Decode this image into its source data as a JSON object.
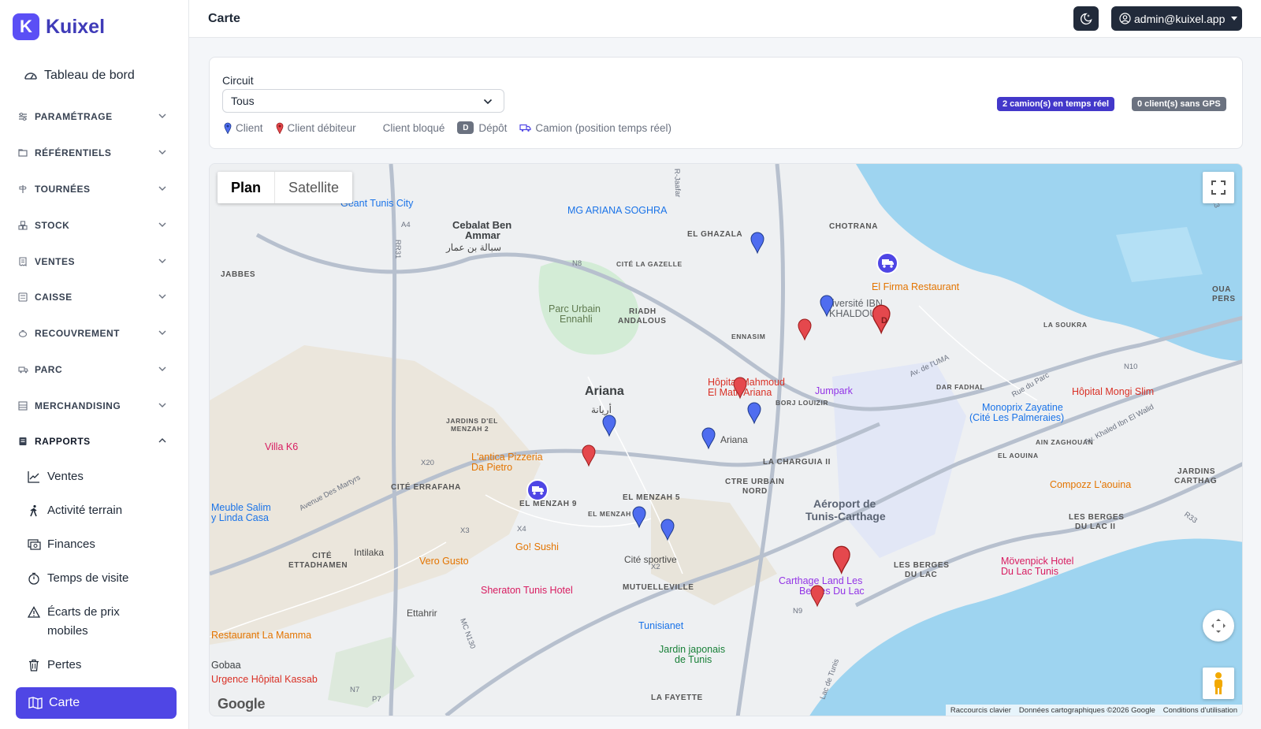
{
  "brand": {
    "name": "Kuixel",
    "logo_letter": "K"
  },
  "sidebar": {
    "dashboard": "Tableau de bord",
    "groups": [
      {
        "label": "PARAMÉTRAGE",
        "icon": "sliders-icon"
      },
      {
        "label": "RÉFÉRENTIELS",
        "icon": "folder-icon"
      },
      {
        "label": "TOURNÉES",
        "icon": "signpost-icon"
      },
      {
        "label": "STOCK",
        "icon": "boxes-icon"
      },
      {
        "label": "VENTES",
        "icon": "receipt-icon"
      },
      {
        "label": "CAISSE",
        "icon": "cash-register-icon"
      },
      {
        "label": "RECOUVREMENT",
        "icon": "piggy-bank-icon"
      },
      {
        "label": "PARC",
        "icon": "truck-icon"
      },
      {
        "label": "MERCHANDISING",
        "icon": "shelf-icon"
      },
      {
        "label": "RAPPORTS",
        "icon": "report-icon"
      }
    ],
    "report_items": [
      {
        "label": "Ventes",
        "icon": "graph-up-icon"
      },
      {
        "label": "Activité terrain",
        "icon": "person-walking-icon"
      },
      {
        "label": "Finances",
        "icon": "cash-icon"
      },
      {
        "label": "Temps de visite",
        "icon": "stopwatch-icon"
      },
      {
        "label": "Écarts de prix mobiles",
        "icon": "warning-icon"
      },
      {
        "label": "Pertes",
        "icon": "trash-icon"
      }
    ],
    "active_item": "Carte"
  },
  "header": {
    "title": "Carte",
    "user": "admin@kuixel.app"
  },
  "filters": {
    "circuit_label": "Circuit",
    "circuit_value": "Tous",
    "legend": {
      "client": "Client",
      "debtor": "Client débiteur",
      "blocked": "Client bloqué",
      "depot_letter": "D",
      "depot": "Dépôt",
      "truck": "Camion (position temps réel)"
    },
    "badge_trucks": "2 camion(s) en temps réel",
    "badge_nogps": "0 client(s) sans GPS"
  },
  "map": {
    "type_plan": "Plan",
    "type_satellite": "Satellite",
    "logo": "Google",
    "attribution": [
      "Raccourcis clavier",
      "Données cartographiques ©2026 Google",
      "Conditions d'utilisation"
    ],
    "labels": {
      "ariana": "Ariana",
      "ariana_ar": "أريانة",
      "cebalat": "Cebalat Ben",
      "cebalat2": "Ammar",
      "cebalat_ar": "سبالة بن عمار",
      "ghazala": "EL GHAZALA",
      "chotrana": "CHOTRANA",
      "jabbes": "JABBES",
      "cite_gazelle": "CITÉ LA GAZELLE",
      "parc_urbain": "Parc Urbain",
      "parc_urbain2": "Ennahli",
      "riadh": "RIADH",
      "riadh2": "ANDALOUS",
      "ennasim": "ENNASIM",
      "la_soukra": "LA SOUKRA",
      "dar_fadhal": "DAR FADHAL",
      "borj_louizir": "BORJ LOUIZIR",
      "jardins_menzah": "JARDINS D'EL",
      "jardins_menzah2": "MENZAH 2",
      "cite_erraf": "CITÉ ERRAFAHA",
      "el_menzah9": "EL MENZAH 9",
      "el_menzah5": "EL MENZAH 5",
      "el_menzah": "EL MENZAH",
      "la_charguia": "LA CHARGUIA II",
      "ctre_urbain": "CTRE URBAIN",
      "ctre_urbain2": "NORD",
      "aeroport": "Aéroport de",
      "aeroport2": "Tunis-Carthage",
      "el_aouina": "EL AOUINA",
      "ain_zaghouan": "AIN ZAGHOUAN",
      "jardins_carthage": "JARDINS",
      "jardins_carthage2": "CARTHAG",
      "berges_lac2": "LES BERGES",
      "berges_lac2b": "DU LAC II",
      "berges_lac": "LES BERGES",
      "berges_lac_b": "DU LAC",
      "cite_ettadhamen": "CITÉ",
      "cite_ettadhamen2": "ETTADHAMEN",
      "intilaka": "Intilaka",
      "mutuelleville": "MUTUELLEVILLE",
      "la_fayette": "LA FAYETTE",
      "ettahrir": "Ettahrir",
      "cite_sportive": "Cité sportive",
      "ariana_metro": "Ariana",
      "ouad": "OUA",
      "pers": "PERS",
      "geant": "Géant Tunis City",
      "mg_ariana": "MG ARIANA SOGHRA",
      "el_firma": "El Firma Restaurant",
      "univ": "Université IBN",
      "univ2": "KHALDOUN",
      "hopital_mahmoud": "Hôpital Mahmoud",
      "hopital_mahmoud2": "El Matri Ariana",
      "jumpark": "Jumpark",
      "monoprix": "Monoprix Zayatine",
      "monoprix2": "(Cité Les Palmeraies)",
      "hopital_mongi": "Hôpital Mongi Slim",
      "compozz": "Compozz L'aouina",
      "villa_k6": "Villa K6",
      "antica": "L'antica Pizzeria",
      "antica2": "Da Pietro",
      "gosushi": "Go! Sushi",
      "vero_gusto": "Vero Gusto",
      "sheraton": "Sheraton Tunis Hotel",
      "meuble": "Meuble Salim",
      "meuble2": "y Linda Casa",
      "restaurant_mamma": "Restaurant La Mamma",
      "gobaa": "Gobaa",
      "urgence": "Urgence Hôpital Kassab",
      "tunisianet": "Tunisianet",
      "jardin_japonais": "Jardin japonais",
      "jardin_japonais2": "de Tunis",
      "carthage_land": "Carthage Land Les",
      "carthage_land2": "Berges Du Lac",
      "movenpick": "Mövenpick Hotel",
      "movenpick2": "Du Lac Tunis",
      "lac_tunis": "Lac de Tunis",
      "av_uma": "Av. de l'UMA",
      "rue_pur": "Rue du Parc",
      "av_khaled": "Av. Khaled Ibn El Walid",
      "av_martyrs": "Avenue Des Martyrs",
      "r_a4": "A4",
      "r_n8": "N8",
      "r_n9": "N9",
      "r_n10": "N10",
      "r_rr31": "RR31",
      "r_x20": "X20",
      "r_x3": "X3",
      "r_x4": "X4",
      "r_x2": "X2",
      "r_n7": "N7",
      "r_p7": "P7",
      "r_r23": "R23",
      "r_r33": "R33",
      "r_mcn130": "MC N130",
      "r_jaafar": "R-Jaafar"
    }
  }
}
